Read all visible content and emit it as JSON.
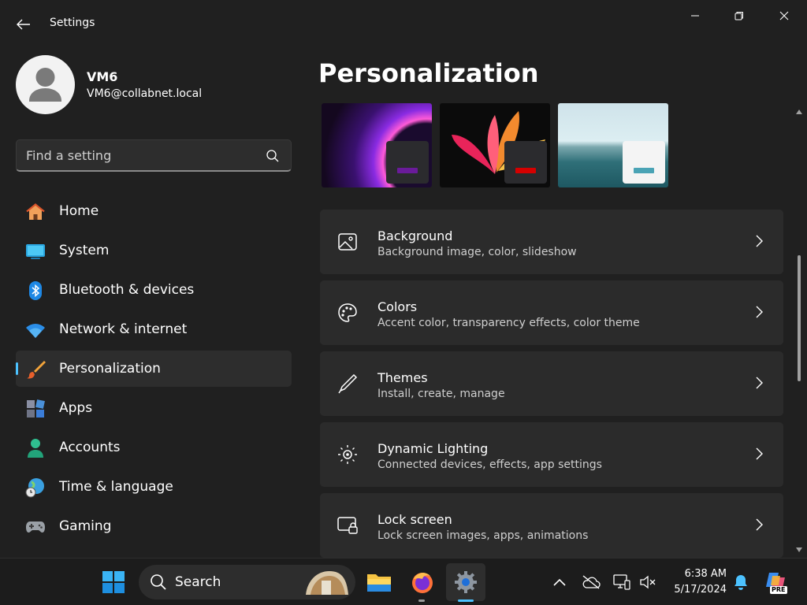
{
  "window": {
    "title": "Settings",
    "controls": [
      "minimize",
      "restore",
      "close"
    ]
  },
  "profile": {
    "name": "VM6",
    "email": "VM6@collabnet.local"
  },
  "search": {
    "placeholder": "Find a setting"
  },
  "sidebar": {
    "items": [
      {
        "label": "Home",
        "icon": "home-icon"
      },
      {
        "label": "System",
        "icon": "system-icon"
      },
      {
        "label": "Bluetooth & devices",
        "icon": "bluetooth-icon"
      },
      {
        "label": "Network & internet",
        "icon": "wifi-icon"
      },
      {
        "label": "Personalization",
        "icon": "brush-icon",
        "active": true
      },
      {
        "label": "Apps",
        "icon": "apps-icon"
      },
      {
        "label": "Accounts",
        "icon": "accounts-icon"
      },
      {
        "label": "Time & language",
        "icon": "globe-clock-icon"
      },
      {
        "label": "Gaming",
        "icon": "gamepad-icon"
      }
    ]
  },
  "main": {
    "title": "Personalization",
    "themes": [
      {
        "name": "dark-purple-glow",
        "accent": "#6a1b9a"
      },
      {
        "name": "dark-flower",
        "accent": "#d50000"
      },
      {
        "name": "lake",
        "accent": "#4aa3b5"
      }
    ],
    "cards": [
      {
        "title": "Background",
        "subtitle": "Background image, color, slideshow",
        "icon": "image-icon"
      },
      {
        "title": "Colors",
        "subtitle": "Accent color, transparency effects, color theme",
        "icon": "palette-icon"
      },
      {
        "title": "Themes",
        "subtitle": "Install, create, manage",
        "icon": "pen-icon"
      },
      {
        "title": "Dynamic Lighting",
        "subtitle": "Connected devices, effects, app settings",
        "icon": "lighting-icon"
      },
      {
        "title": "Lock screen",
        "subtitle": "Lock screen images, apps, animations",
        "icon": "lock-screen-icon"
      }
    ]
  },
  "taskbar": {
    "search_label": "Search",
    "time": "6:38 AM",
    "date": "5/17/2024",
    "apps": [
      "windows-start-icon",
      "search-icon",
      "file-explorer-icon",
      "firefox-icon",
      "settings-icon"
    ],
    "tray": [
      "chevron-up-icon",
      "cloud-offline-icon",
      "network-icon",
      "volume-muted-icon",
      "notification-bell-icon",
      "copilot-icon"
    ],
    "copilot_badge": "PRE"
  },
  "colors": {
    "accent": "#4cc2ff",
    "background": "#202020",
    "card": "#2b2b2b"
  }
}
